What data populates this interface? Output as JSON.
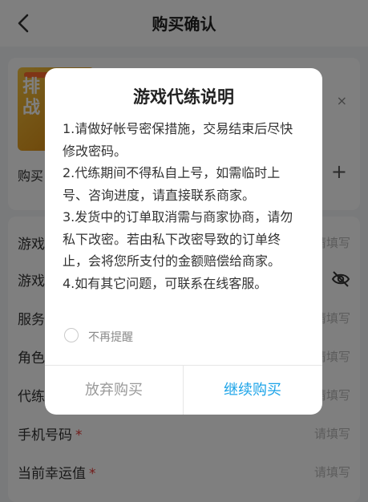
{
  "header": {
    "title": "购买确认"
  },
  "product": {
    "thumb_text": "排战",
    "quantity_label": "购买",
    "plus": "+",
    "close_glyph": "×"
  },
  "form": {
    "rows": [
      {
        "label": "游戏",
        "required": false,
        "placeholder": "请填写"
      },
      {
        "label": "游戏",
        "required": false,
        "placeholder": ""
      },
      {
        "label": "服务",
        "required": false,
        "placeholder": "请填写"
      },
      {
        "label": "角色",
        "required": false,
        "placeholder": "请填写"
      },
      {
        "label": "代练",
        "required": false,
        "placeholder": "请填写"
      },
      {
        "label": "手机号码",
        "required": true,
        "placeholder": "请填写"
      },
      {
        "label": "当前幸运值",
        "required": true,
        "placeholder": "请填写"
      }
    ],
    "required_mark": "*"
  },
  "dialog": {
    "title": "游戏代练说明",
    "rules": [
      "1.请做好帐号密保措施，交易结束后尽快修改密码。",
      "2.代练期间不得私自上号，如需临时上号、咨询进度，请直接联系商家。",
      "3.发货中的订单取消需与商家协商，请勿私下改密。若由私下改密导致的订单终止，会将您所支付的金额赔偿给商家。",
      "4.如有其它问题，可联系在线客服。"
    ],
    "no_remind_label": "不再提醒",
    "cancel_label": "放弃购买",
    "continue_label": "继续购买"
  },
  "colors": {
    "accent": "#1aa3e8",
    "required": "#e53935"
  }
}
